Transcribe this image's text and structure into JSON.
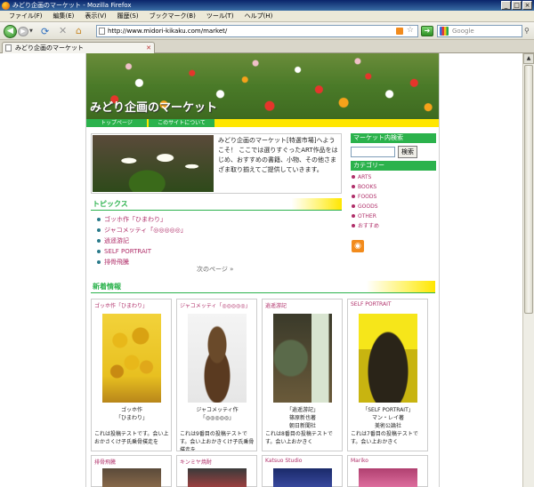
{
  "window": {
    "title": "みどり企画のマーケット - Mozilla Firefox"
  },
  "menu": [
    "ファイル(F)",
    "編集(E)",
    "表示(V)",
    "履歴(S)",
    "ブックマーク(B)",
    "ツール(T)",
    "ヘルプ(H)"
  ],
  "toolbar": {
    "url": "http://www.midori-kikaku.com/market/",
    "search_placeholder": "Google"
  },
  "tab": {
    "label": "みどり企画のマーケット"
  },
  "site": {
    "title": "みどり企画のマーケット",
    "nav": {
      "top": "トップページ",
      "about": "このサイトについて"
    },
    "intro": "みどり企画のマーケット[特選市場]へようこそ！ ここでは選りすぐったART作品をはじめ、おすすめの書籍、小物、その他さまざま取り揃えてご提供していきます。"
  },
  "topics": {
    "heading": "トピックス",
    "items": [
      "ゴッホ作「ひまわり」",
      "ジャコメッティ「◎◎◎◎◎」",
      "逍遥游記",
      "SELF PORTRAIT",
      "排骨飛騰"
    ],
    "next": "次のページ »"
  },
  "sidebar": {
    "search_heading": "マーケット内検索",
    "search_button": "検索",
    "category_heading": "カテゴリー",
    "categories": [
      "ARTS",
      "BOOKS",
      "FOODS",
      "GOODS",
      "OTHER",
      "おすすめ"
    ]
  },
  "news": {
    "heading": "新着情報",
    "cards": [
      {
        "title": "ゴッホ作「ひまわり」",
        "cap1": "ゴッホ作",
        "cap2": "「ひまわり」",
        "desc": "これは投稿テストです。会い上おかさくけ子氏乗骨撲走を"
      },
      {
        "title": "ジャコメッティ「◎◎◎◎◎」",
        "cap1": "ジャコメッティ作",
        "cap2": "「◎◎◎◎◎」",
        "desc": "これは9番目の投稿テストです。会い上おかきくけ子氏乗骨撲走を"
      },
      {
        "title": "逍遥游記",
        "cap1": "「逍遥游記」",
        "cap2": "篠原新也著",
        "cap3": "朝日新聞社",
        "desc": "これは8番目の投稿テストです。会い上おかきく"
      },
      {
        "title": "SELF PORTRAIT",
        "cap1": "「SELF PORTRAIT」",
        "cap2": "マン・レイ著",
        "cap3": "美術公論社",
        "desc": "これは7番目の投稿テストです。会い上おかきく"
      }
    ],
    "row2": [
      "排骨飛騰",
      "キンミヤ焼酎",
      "Katsuo Studio",
      "Mariko"
    ]
  }
}
